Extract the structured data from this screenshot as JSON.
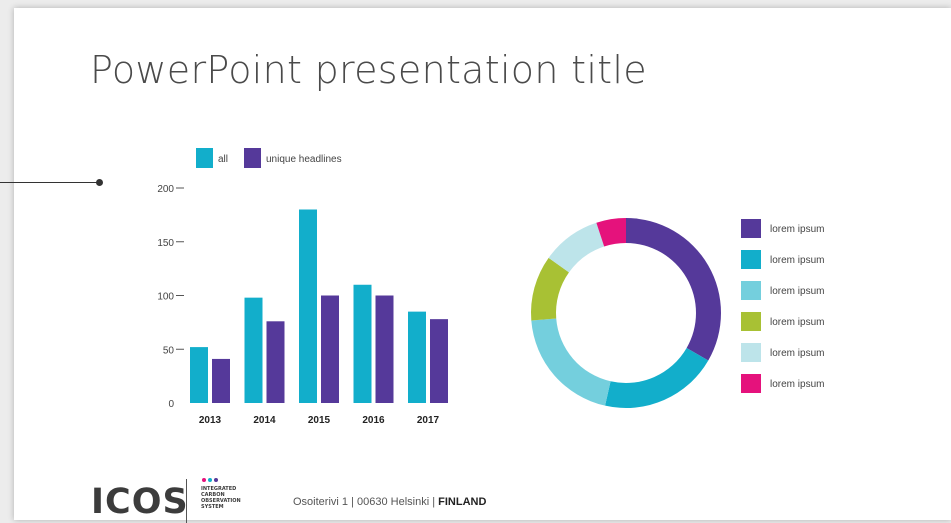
{
  "slide": {
    "title": "PowerPoint presentation title"
  },
  "chart_data": [
    {
      "type": "bar",
      "categories": [
        "2013",
        "2014",
        "2015",
        "2016",
        "2017"
      ],
      "series": [
        {
          "name": "all",
          "values": [
            52,
            98,
            180,
            110,
            85
          ],
          "color": "#12aecb"
        },
        {
          "name": "unique headlines",
          "values": [
            41,
            76,
            100,
            100,
            78
          ],
          "color": "#55399a"
        }
      ],
      "yticks": [
        "0",
        "50",
        "100",
        "150",
        "200"
      ],
      "ylim": [
        0,
        200
      ],
      "legend_position": "top",
      "grid": false
    },
    {
      "type": "pie",
      "style": "donut",
      "slices": [
        {
          "label": "lorem ipsum",
          "value": 33,
          "color": "#55399a"
        },
        {
          "label": "lorem ipsum",
          "value": 20,
          "color": "#12aecb"
        },
        {
          "label": "lorem ipsum",
          "value": 20,
          "color": "#74cfdd"
        },
        {
          "label": "lorem ipsum",
          "value": 11,
          "color": "#a8c134"
        },
        {
          "label": "lorem ipsum",
          "value": 10,
          "color": "#bde4ea"
        },
        {
          "label": "lorem ipsum",
          "value": 5,
          "color": "#e5127c"
        }
      ],
      "legend_position": "right"
    }
  ],
  "footer": {
    "logo_text": "ICOS",
    "logo_dot_colors": [
      "#e5127c",
      "#12aecb",
      "#55399a"
    ],
    "logo_subtitle": [
      "INTEGRATED",
      "CARBON",
      "OBSERVATION",
      "SYSTEM"
    ],
    "address": "Osoiterivi 1 | 00630 Helsinki | ",
    "country": "FINLAND"
  }
}
